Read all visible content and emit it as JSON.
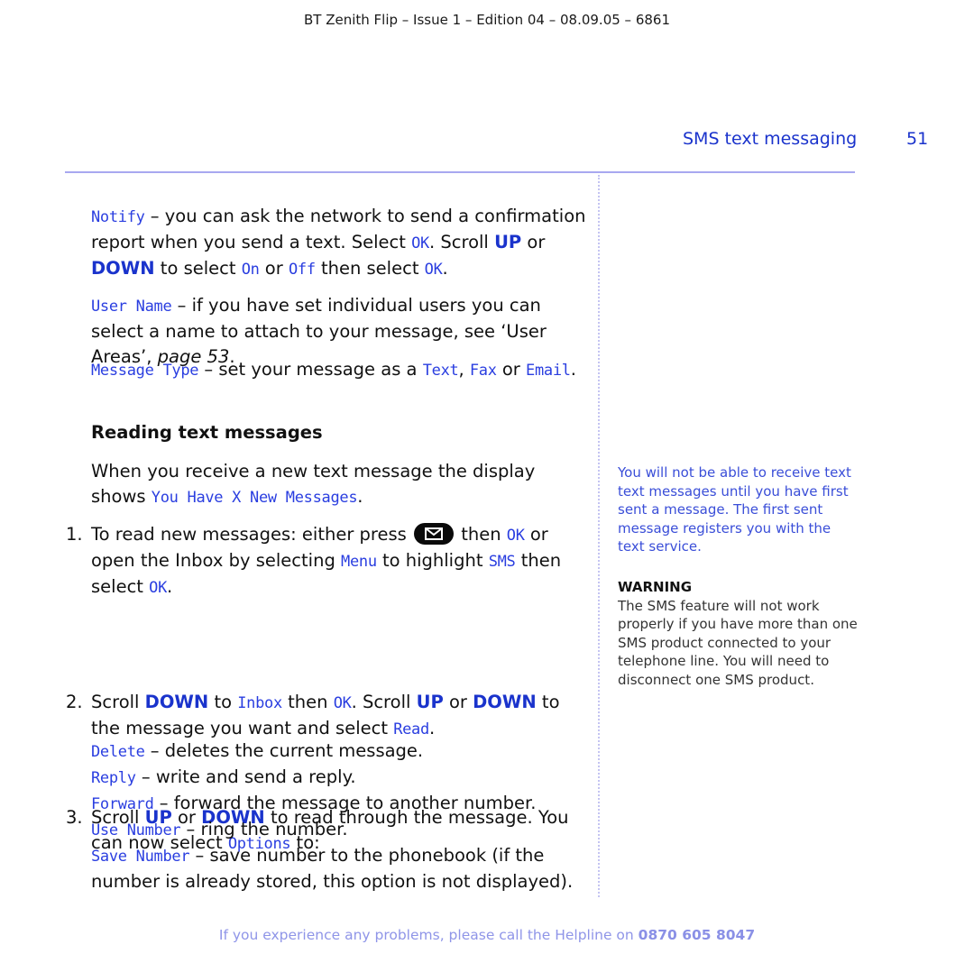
{
  "header": {
    "doc_id": "BT Zenith Flip – Issue 1 – Edition 04 – 08.09.05 – 6861",
    "section_title": "SMS text messaging",
    "page_number": "51"
  },
  "main": {
    "notify": {
      "term": "Notify",
      "t1": " – you can ask the network to send a confirmation report when you send a text. Select ",
      "ok1": "OK",
      "t2": ". Scroll ",
      "up": "UP",
      "t3": " or ",
      "down": "DOWN",
      "t4": " to select ",
      "on": "On",
      "t5": " or ",
      "off": "Off",
      "t6": " then select ",
      "ok2": "OK",
      "t7": "."
    },
    "user_name": {
      "term": "User Name",
      "t1": " – if you have set individual users you can select a name to attach to your message, see ‘User Areas’, ",
      "page_ref": "page 53",
      "t2": "."
    },
    "message_type": {
      "term": "Message Type",
      "t1": " – set your message as a ",
      "text": "Text",
      "t2": ", ",
      "fax": "Fax",
      "t3": " or ",
      "email": "Email",
      "t4": "."
    },
    "reading_heading": "Reading text messages",
    "intro": {
      "t1": "When you receive a new text message the display shows ",
      "display": "You Have X New Messages",
      "t2": "."
    },
    "steps": [
      {
        "num": "1.",
        "t1": "To read new messages: either press ",
        "icon": "envelope-key",
        "t2": " then ",
        "ok": "OK",
        "t3": " or open the Inbox by selecting ",
        "menu": "Menu",
        "t4": " to highlight ",
        "sms": "SMS",
        "t5": " then select ",
        "ok2": "OK",
        "t6": "."
      },
      {
        "num": "2.",
        "t1": "Scroll ",
        "down": "DOWN",
        "t2": " to ",
        "inbox": "Inbox",
        "t3": " then ",
        "ok": "OK",
        "t4": ". Scroll ",
        "up": "UP",
        "t5": " or ",
        "down2": "DOWN",
        "t6": " to the message you want and select ",
        "read": "Read",
        "t7": "."
      },
      {
        "num": "3.",
        "t1": "Scroll ",
        "up": "UP",
        "t2": " or ",
        "down": "DOWN",
        "t3": " to read through the message. You can now select ",
        "options": "Options",
        "t4": " to:"
      }
    ],
    "options": [
      {
        "term": "Delete",
        "desc": " – deletes the current message."
      },
      {
        "term": "Reply",
        "desc": " – write and send a reply."
      },
      {
        "term": "Forward",
        "desc": " – forward the message to another number."
      },
      {
        "term": "Use Number",
        "desc": " – ring the number."
      },
      {
        "term": "Save Number",
        "desc": " – save number to the phonebook (if the number is already stored, this option is not displayed)."
      }
    ]
  },
  "sidebar": {
    "note": "You will not be able to receive text text messages until you have first sent a message. The first sent message registers you with the text service.",
    "warning_title": "WARNING",
    "warning_text": "The SMS feature will not work properly if you have more than one SMS product connected to your telephone line. You will need to disconnect one SMS product."
  },
  "footer": {
    "text": "If you experience any problems, please call the Helpline on ",
    "phone": "0870 605 8047"
  },
  "colors": {
    "accent_blue": "#1a33cc",
    "lcd_blue": "#2a3ee0",
    "rule": "#a8a8f0",
    "footer": "#8f95e8"
  }
}
